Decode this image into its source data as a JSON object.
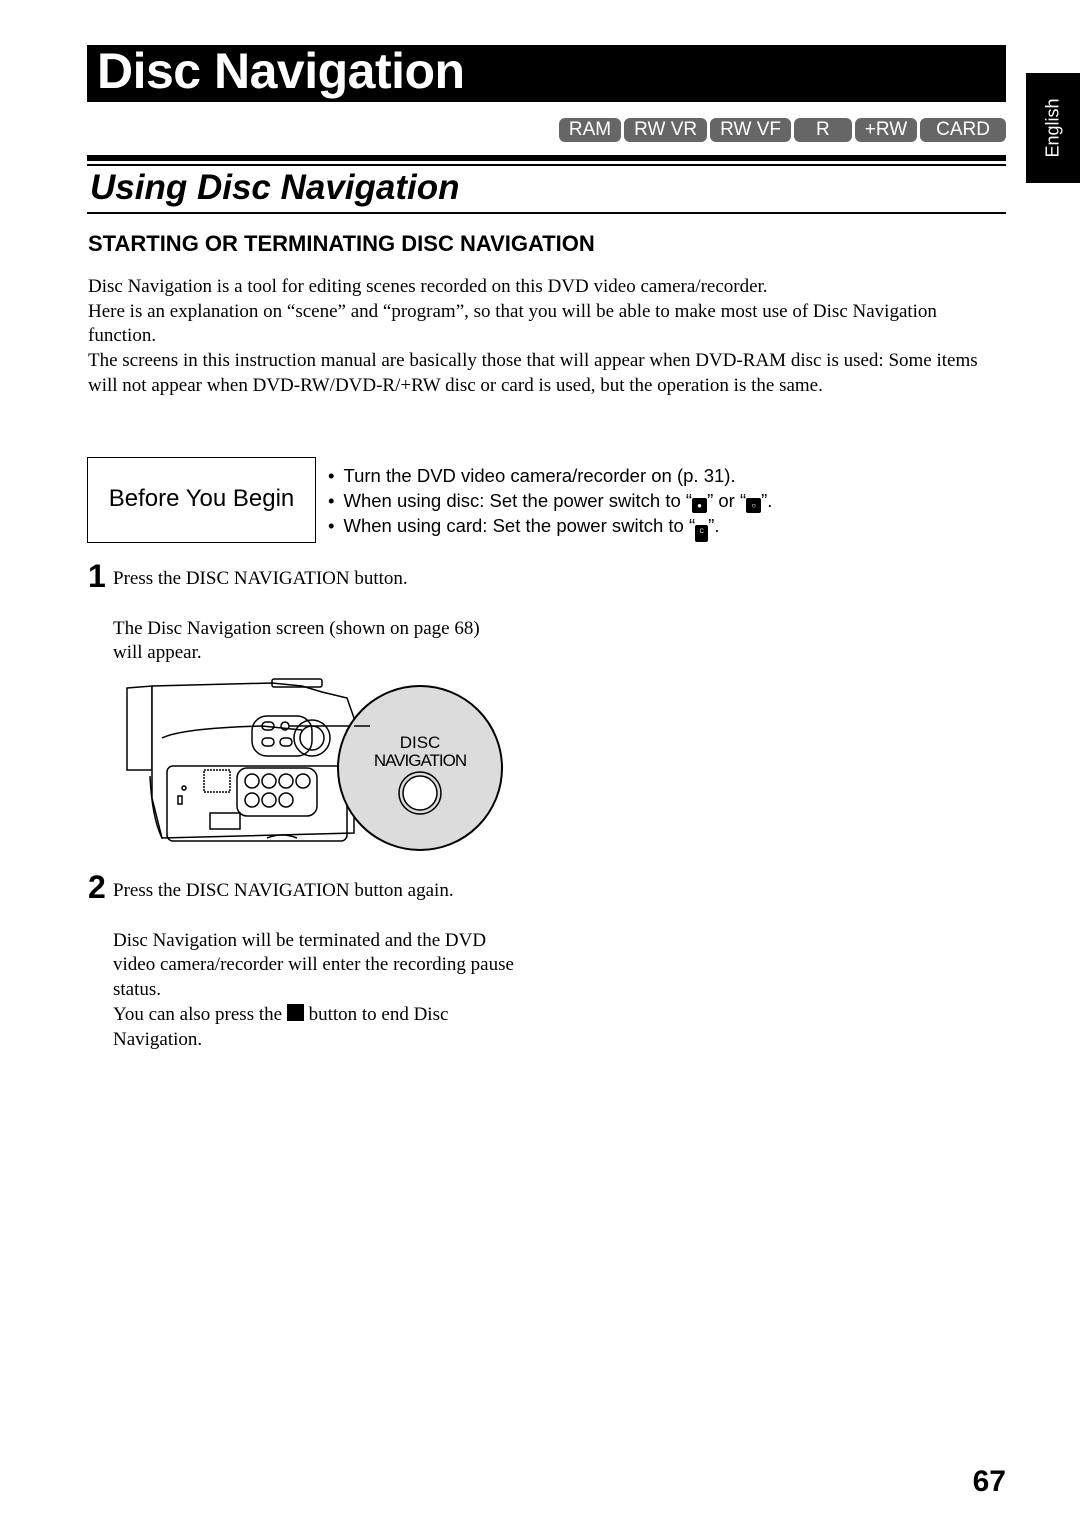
{
  "header": {
    "title": "Disc Navigation",
    "media_badges": [
      "RAM",
      "RW VR",
      "RW VF",
      "R",
      "+RW",
      "CARD"
    ],
    "language_tab": "English"
  },
  "section": {
    "title": "Using Disc Navigation",
    "subheading": "STARTING OR TERMINATING DISC NAVIGATION",
    "intro": [
      "Disc Navigation is a tool for editing scenes recorded on this DVD video camera/recorder.",
      "Here is an explanation on “scene” and “program”, so that you will be able to make most use of Disc Navigation function.",
      "The screens in this instruction manual are basically those that will appear when DVD-RAM disc is used: Some items will not appear when DVD-RW/DVD-R/+RW disc or card is used, but the operation is the same."
    ]
  },
  "before_you_begin": {
    "label": "Before You Begin",
    "items": [
      {
        "text": "Turn the DVD video camera/recorder on (p. 31)."
      },
      {
        "pre": "When using disc: Set the power switch to “",
        "mid": "” or “",
        "post": "”.",
        "icons": [
          "movie-camera-icon",
          "still-camera-icon"
        ]
      },
      {
        "pre": "When using card: Set the power switch to “",
        "post": "”.",
        "icons": [
          "card-icon"
        ]
      }
    ]
  },
  "steps": [
    {
      "number": "1",
      "instruction": "Press the DISC NAVIGATION button.",
      "detail": [
        "The Disc Navigation screen (shown on page 68) will appear."
      ]
    },
    {
      "number": "2",
      "instruction": "Press the DISC NAVIGATION button again.",
      "detail": [
        "Disc Navigation will be terminated and the DVD video camera/recorder will enter the recording pause status.",
        "You can also press the",
        "button to end Disc Navigation."
      ]
    }
  ],
  "illustration": {
    "callout_line1": "DISC",
    "callout_line2": "NAVIGATION"
  },
  "footer": {
    "page_number": "67"
  }
}
